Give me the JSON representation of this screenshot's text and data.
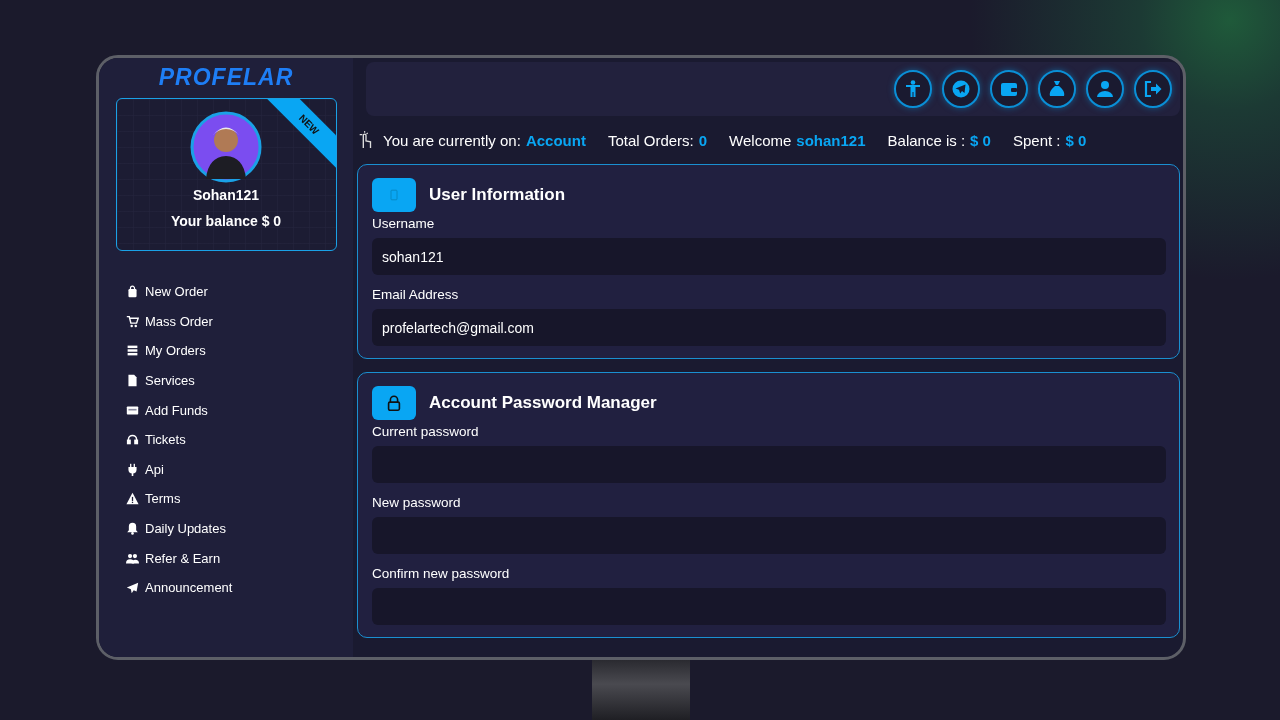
{
  "brand": "PROFELAR",
  "profile": {
    "badge": "NEW",
    "name": "Sohan121",
    "balance": "Your balance $ 0"
  },
  "nav": [
    {
      "label": "New Order"
    },
    {
      "label": "Mass Order"
    },
    {
      "label": "My Orders"
    },
    {
      "label": "Services"
    },
    {
      "label": "Add Funds"
    },
    {
      "label": "Tickets"
    },
    {
      "label": "Api"
    },
    {
      "label": "Terms"
    },
    {
      "label": "Daily Updates"
    },
    {
      "label": "Refer & Earn"
    },
    {
      "label": "Announcement"
    }
  ],
  "status": [
    {
      "label": "You are currently on:",
      "value": "Account"
    },
    {
      "label": "Total Orders:",
      "value": "0"
    },
    {
      "label": "Welcome",
      "value": "sohan121"
    },
    {
      "label": "Balance is :",
      "value": "$ 0"
    },
    {
      "label": "Spent :",
      "value": "$ 0"
    }
  ],
  "sections": [
    {
      "kind": "info",
      "title": "User Information",
      "fields": [
        {
          "label": "Username",
          "value": "sohan121"
        },
        {
          "label": "Email Address",
          "value": "profelartech@gmail.com"
        }
      ]
    },
    {
      "kind": "lock",
      "title": "Account Password Manager",
      "fields": [
        {
          "label": "Current password"
        },
        {
          "label": "New password"
        },
        {
          "label": "Confirm new password"
        }
      ]
    }
  ]
}
